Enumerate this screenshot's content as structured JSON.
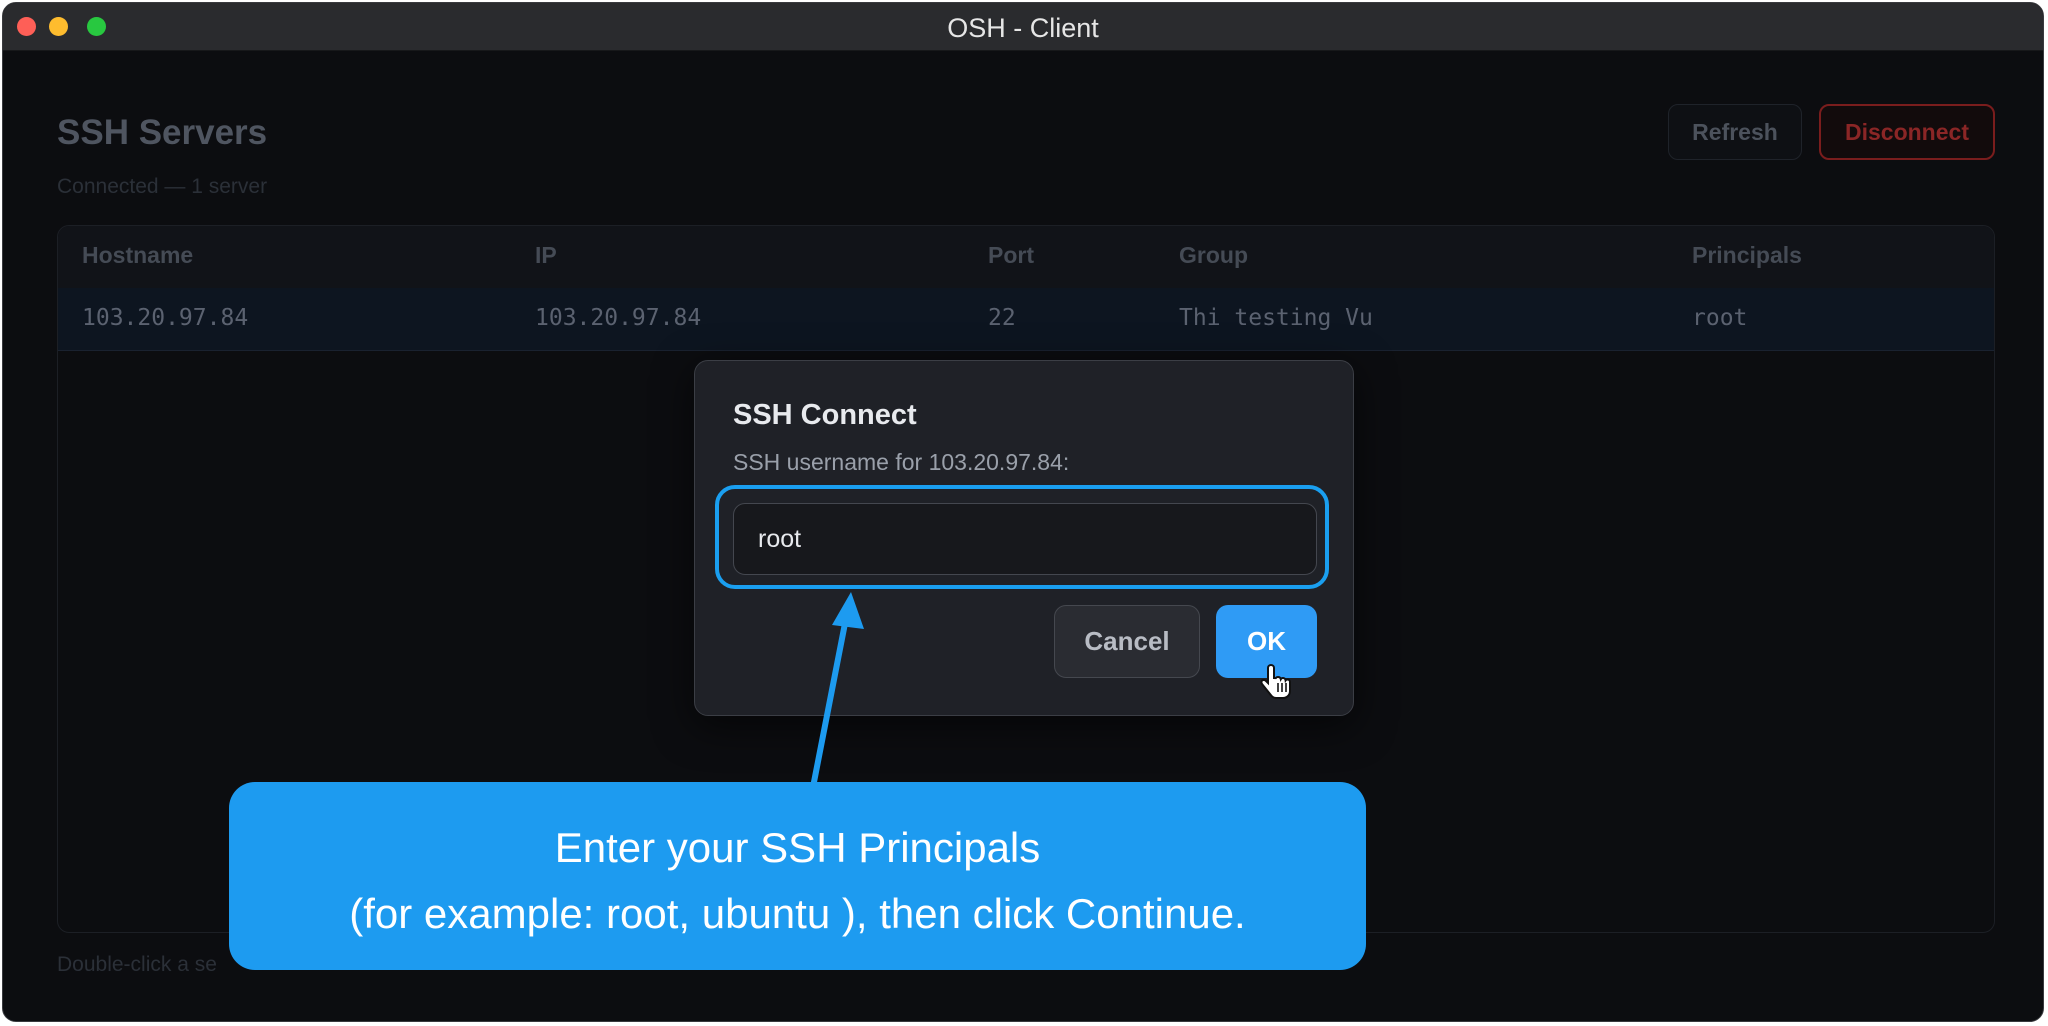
{
  "window": {
    "title": "OSH - Client"
  },
  "header": {
    "title": "SSH Servers",
    "status": "Connected — 1 server",
    "refresh_label": "Refresh",
    "disconnect_label": "Disconnect"
  },
  "table": {
    "columns": [
      "Hostname",
      "IP",
      "Port",
      "Group",
      "Principals"
    ],
    "rows": [
      {
        "hostname": "103.20.97.84",
        "ip": "103.20.97.84",
        "port": "22",
        "group": "Thi testing Vu",
        "principals": "root"
      }
    ]
  },
  "footer": {
    "hint": "Double-click a se"
  },
  "dialog": {
    "title": "SSH Connect",
    "subtitle": "SSH username for 103.20.97.84:",
    "input_value": "root",
    "cancel_label": "Cancel",
    "ok_label": "OK"
  },
  "callout": {
    "line1": "Enter your SSH Principals",
    "line2": "(for example: root, ubuntu ), then click Continue."
  },
  "colors": {
    "accent": "#1d9bf0",
    "ok_button": "#2f9bf5",
    "danger": "#8b2626",
    "background": "#0c0d10"
  },
  "icons": {
    "cursor": "hand-pointer-icon"
  }
}
